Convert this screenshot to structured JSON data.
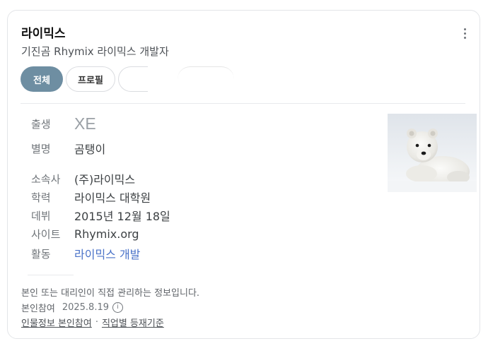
{
  "header": {
    "title": "라이믹스",
    "subtitle": "기진곰 Rhymix 라이믹스 개발자",
    "more_icon": "vertical-ellipsis-icon"
  },
  "tabs": [
    {
      "label": "전체",
      "active": true
    },
    {
      "label": "프로필",
      "active": false
    },
    {
      "label": "",
      "active": false
    },
    {
      "label": "",
      "active": false
    }
  ],
  "photo": {
    "icon": "polar-bear-cub-photo"
  },
  "profile": [
    {
      "label": "출생",
      "value": "XE"
    },
    {
      "label": "별명",
      "value": "곰탱이"
    },
    {
      "label": "소속사",
      "value": "(주)라이믹스"
    },
    {
      "label": "학력",
      "value": "라이믹스 대학원"
    },
    {
      "label": "데뷔",
      "value": "2015년 12월 18일"
    },
    {
      "label": "사이트",
      "value": "Rhymix.org"
    },
    {
      "label": "활동",
      "value": "라이믹스 개발"
    }
  ],
  "notice": {
    "text": "본인 또는 대리인이 직접 관리하는 정보입니다.",
    "verified_label": "본인참여",
    "verified_date": "2025.8.19",
    "info_icon": "ⓘ"
  },
  "footer": {
    "link1": "인물정보 본인참여",
    "separator": "·",
    "link2": "직업별 등재기준"
  },
  "colors": {
    "active_tab": "#6e8ea2",
    "link": "#4a72c8"
  }
}
